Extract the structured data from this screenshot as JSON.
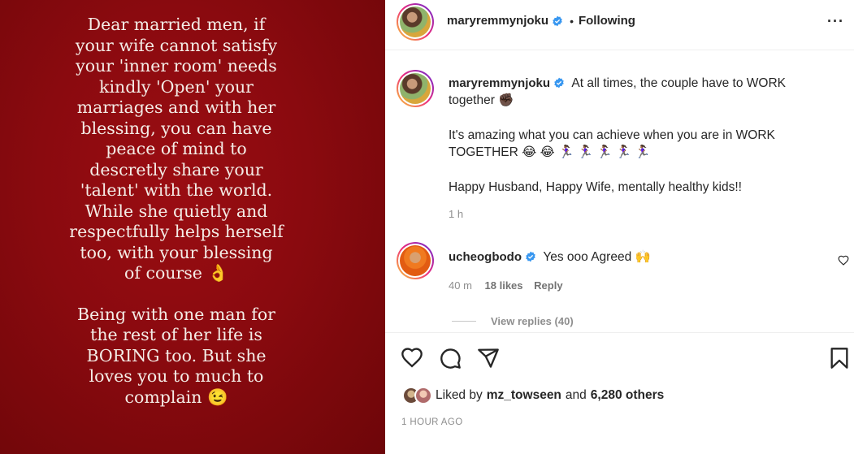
{
  "media": {
    "paragraph1": [
      "Dear married men, if",
      "your wife cannot satisfy",
      "your 'inner room' needs",
      "kindly 'Open' your",
      "marriages and with her",
      "blessing, you can have",
      "peace of mind to",
      "descretly share your",
      "'talent' with the world.",
      "While she quietly and",
      "respectfully helps herself",
      "too, with your blessing",
      "of course 👌"
    ],
    "paragraph2": [
      "Being with one man for",
      "the rest of her life is",
      "BORING too. But she",
      "loves you to much to",
      "complain 😉"
    ]
  },
  "header": {
    "username": "maryremmynjoku",
    "separator": "•",
    "following": "Following",
    "more": "···"
  },
  "caption": {
    "username": "maryremmynjoku",
    "line1": "At all times, the couple have to WORK together ✊🏿",
    "line2": "It's amazing what you can achieve when you are in WORK TOGETHER 😂 😂 🏃🏾‍♀️ 🏃🏾‍♀️ 🏃🏾‍♀️ 🏃🏾‍♀️ 🏃🏾‍♀️",
    "line3": "Happy Husband, Happy Wife, mentally healthy kids!!",
    "time": "1 h"
  },
  "comment": {
    "username": "ucheogbodo",
    "text": "Yes ooo Agreed 🙌",
    "time": "40 m",
    "likes": "18 likes",
    "reply": "Reply",
    "view_replies": "View replies (40)"
  },
  "footer": {
    "liked_prefix": "Liked by",
    "liked_user": "mz_towseen",
    "liked_and": "and",
    "liked_others": "6,280 others",
    "timestamp": "1 HOUR AGO"
  },
  "colors": {
    "verified": "#3897f0",
    "media_bg": "#8a0a0f",
    "media_text": "#f4ece6"
  },
  "icons": [
    "heart-icon",
    "comment-icon",
    "share-icon",
    "bookmark-icon",
    "verified-badge-icon",
    "more-options-icon"
  ]
}
